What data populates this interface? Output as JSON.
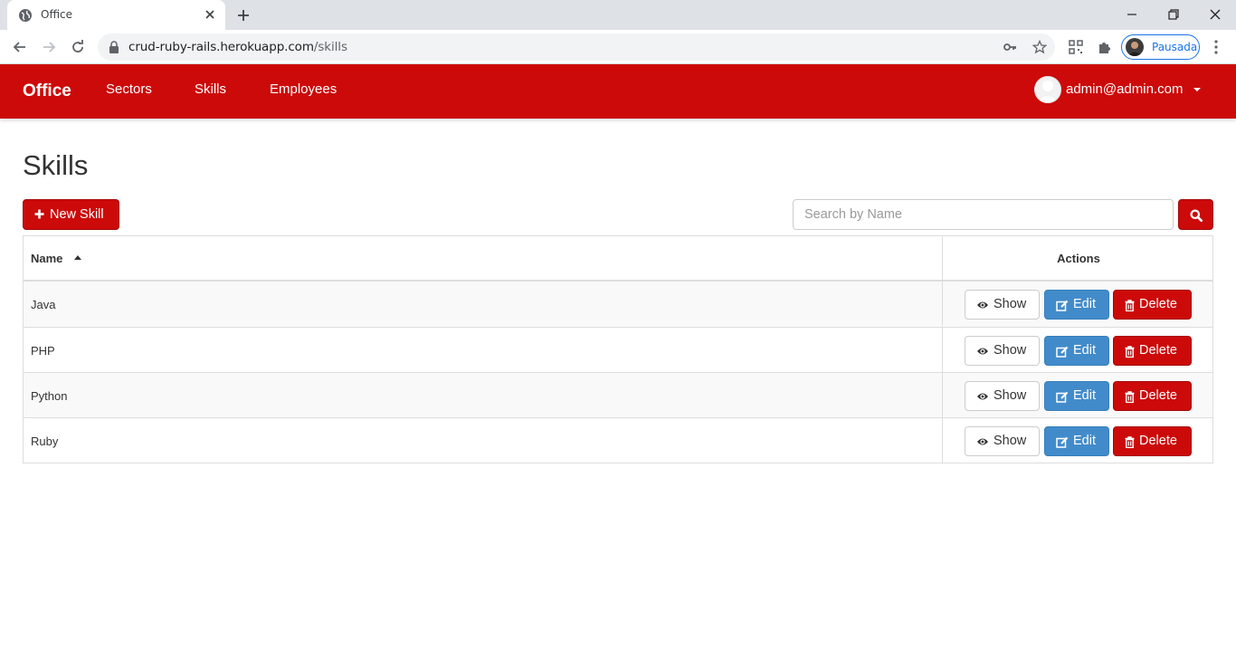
{
  "browser": {
    "tab_title": "Office",
    "url_host": "crud-ruby-rails.herokuapp.com",
    "url_path": "/skills",
    "profile_label": "Pausada"
  },
  "navbar": {
    "brand": "Office",
    "links": [
      "Sectors",
      "Skills",
      "Employees"
    ],
    "user_email": "admin@admin.com"
  },
  "page": {
    "title": "Skills",
    "new_button": "New Skill",
    "search_placeholder": "Search by Name"
  },
  "table": {
    "headers": {
      "name": "Name",
      "actions": "Actions"
    },
    "rows": [
      {
        "name": "Java"
      },
      {
        "name": "PHP"
      },
      {
        "name": "Python"
      },
      {
        "name": "Ruby"
      }
    ],
    "action_labels": {
      "show": "Show",
      "edit": "Edit",
      "delete": "Delete"
    }
  },
  "colors": {
    "brand_red": "#cc0a0a",
    "edit_blue": "#428bca"
  }
}
